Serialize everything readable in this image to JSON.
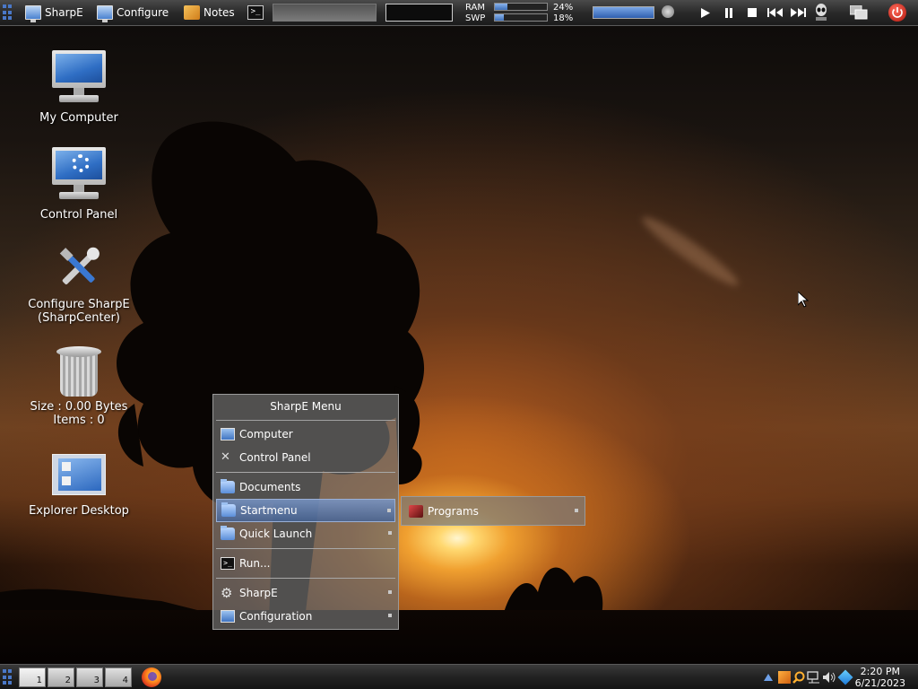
{
  "topbar": {
    "buttons": [
      {
        "label": "SharpE",
        "icon": "monitor-icon"
      },
      {
        "label": "Configure",
        "icon": "monitor-icon"
      },
      {
        "label": "Notes",
        "icon": "notes-icon"
      }
    ],
    "terminal_icon_glyph": ">_",
    "meters": {
      "ram_label": "RAM",
      "ram_value": "24%",
      "ram_fraction": 0.24,
      "swp_label": "SWP",
      "swp_value": "18%",
      "swp_fraction": 0.18
    },
    "media_icons": [
      "play-icon",
      "pause-icon",
      "stop-icon",
      "previous-icon",
      "next-icon"
    ]
  },
  "desktop": {
    "icons": [
      {
        "label": "My Computer"
      },
      {
        "label": "Control Panel"
      },
      {
        "label": "Configure SharpE",
        "label2": "(SharpCenter)"
      },
      {
        "label": "Size : 0.00 Bytes",
        "label2": "Items : 0"
      },
      {
        "label": "Explorer Desktop"
      }
    ]
  },
  "menu": {
    "title": "SharpE Menu",
    "items": [
      {
        "label": "Computer"
      },
      {
        "label": "Control Panel"
      },
      {
        "label": "Documents"
      },
      {
        "label": "Startmenu"
      },
      {
        "label": "Quick Launch"
      },
      {
        "label": "Run..."
      },
      {
        "label": "SharpE"
      },
      {
        "label": "Configuration"
      }
    ],
    "submenu": {
      "label": "Programs"
    }
  },
  "taskbar": {
    "workspaces": [
      "1",
      "2",
      "3",
      "4"
    ],
    "clock": {
      "time": "2:20 PM",
      "date": "6/21/2023"
    }
  },
  "colors": {
    "accent": "#4a78c8",
    "menu_selection": "#6a8cc4",
    "sun_glow": "#f0a030"
  }
}
